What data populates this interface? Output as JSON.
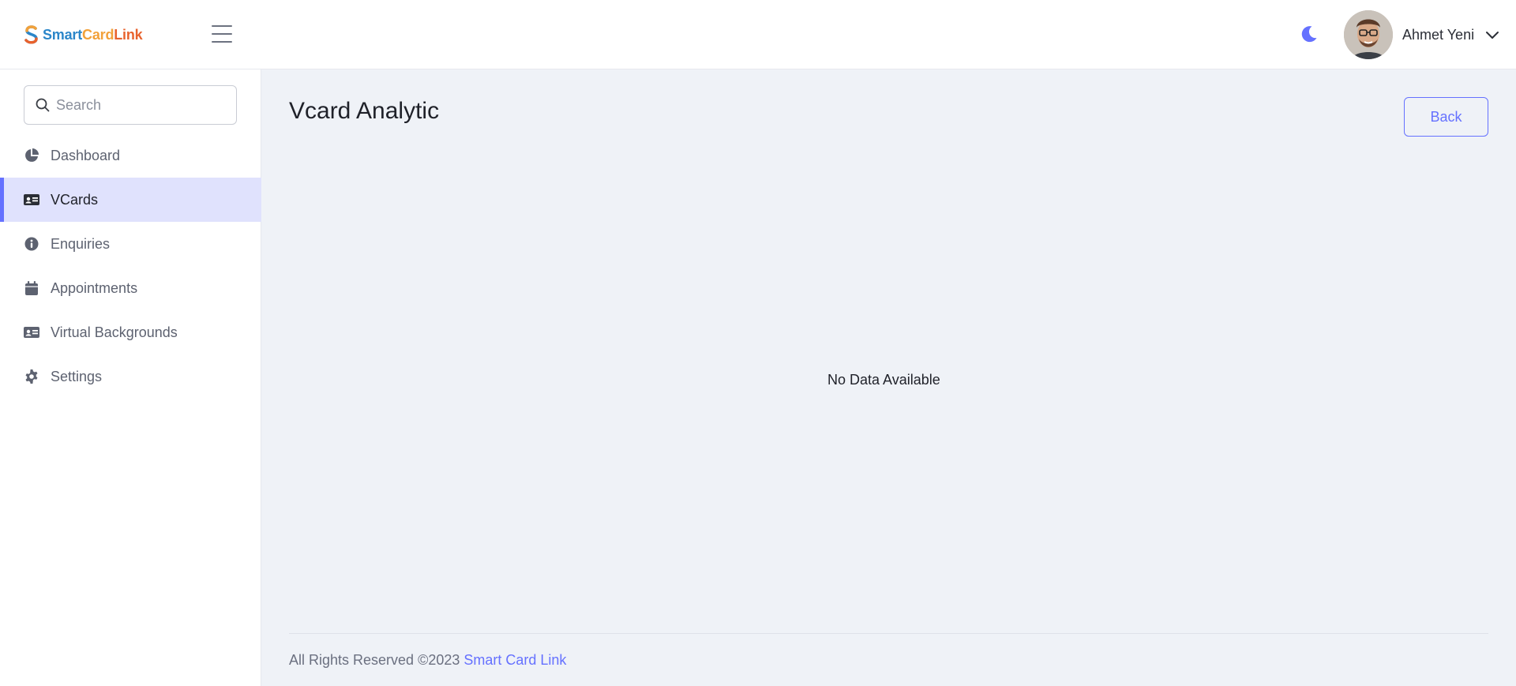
{
  "header": {
    "logo": {
      "part1": "Smart",
      "part2": "Card",
      "part3": "Link"
    },
    "user_name": "Ahmet Yeni"
  },
  "colors": {
    "accent": "#6571ff",
    "active_bg": "#e0e2fd",
    "page_bg": "#eff2f7"
  },
  "sidebar": {
    "search": {
      "placeholder": "Search",
      "value": ""
    },
    "items": [
      {
        "label": "Dashboard",
        "icon": "pie-chart-icon",
        "active": false
      },
      {
        "label": "VCards",
        "icon": "id-card-icon",
        "active": true
      },
      {
        "label": "Enquiries",
        "icon": "info-circle-icon",
        "active": false
      },
      {
        "label": "Appointments",
        "icon": "calendar-icon",
        "active": false
      },
      {
        "label": "Virtual Backgrounds",
        "icon": "id-card-icon",
        "active": false
      },
      {
        "label": "Settings",
        "icon": "gear-icon",
        "active": false
      }
    ]
  },
  "main": {
    "title": "Vcard Analytic",
    "back_label": "Back",
    "empty_message": "No Data Available"
  },
  "footer": {
    "text": "All Rights Reserved ©2023",
    "link_text": "Smart Card Link"
  }
}
